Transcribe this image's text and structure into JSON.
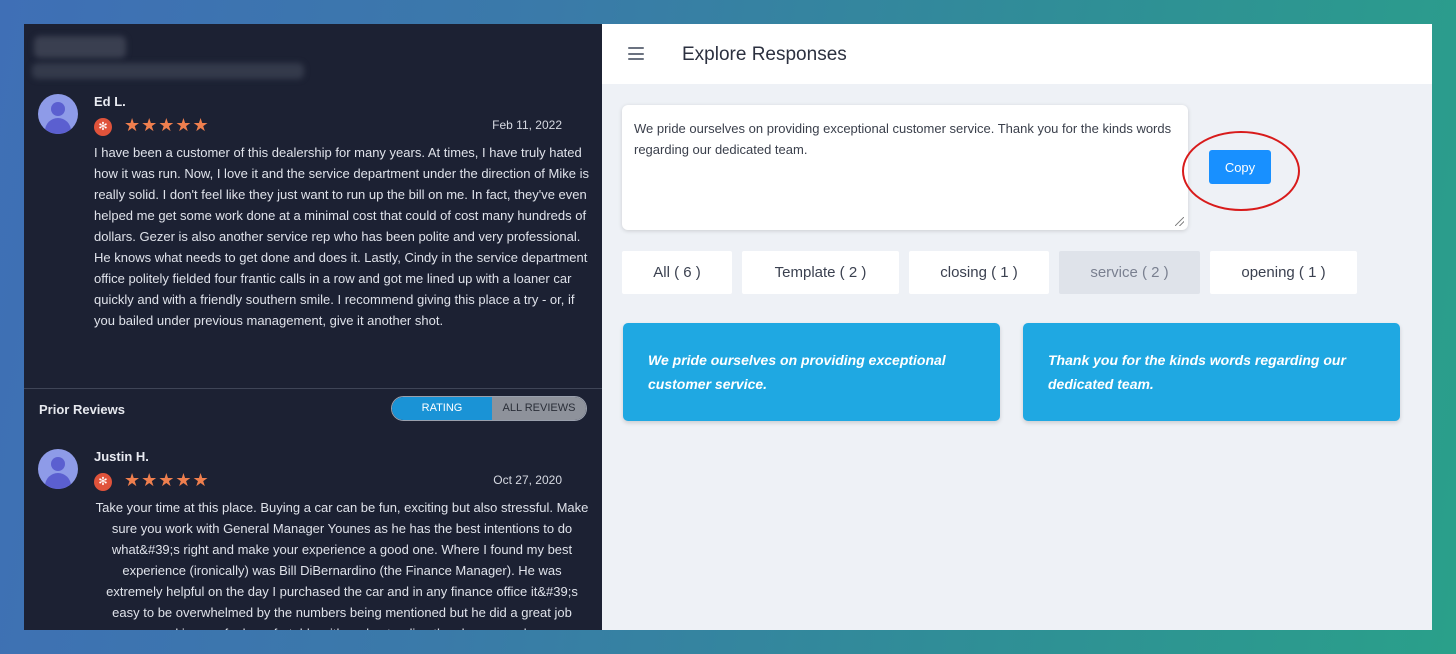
{
  "left": {
    "reviews": [
      {
        "name": "Ed L.",
        "stars": "★★★★★",
        "rating": 5,
        "source_icon": "yelp-icon",
        "date": "Feb 11, 2022",
        "text": "I have been a customer of this dealership for many years. At times, I have truly hated how it was run. Now, I love it and the service department under the direction of Mike is really solid. I don't feel like they just want to run up the bill on me. In fact, they've even helped me get some work done at a minimal cost that could of cost many hundreds of dollars. Gezer is also another service rep who has been polite and very professional.  He knows what needs to get done and does it. Lastly, Cindy in the service department office politely fielded four frantic calls in a row and got me lined up with a loaner car quickly and with a friendly southern smile. I recommend giving this place a try - or, if you bailed under previous management, give it another shot."
      },
      {
        "name": "Justin H.",
        "stars": "★★★★★",
        "rating": 5,
        "source_icon": "yelp-icon",
        "date": "Oct 27, 2020",
        "text": "Take your time at this place. Buying a car can be fun, exciting but also stressful. Make sure you work with General Manager Younes as he has the best intentions to do what&#39;s right and make your experience a good one. Where I found my best experience (ironically) was Bill DiBernardino (the Finance Manager). He was extremely helpful on the day I purchased the car and in any finance office it&#39;s easy to be overwhelmed by the numbers being mentioned but he did a great job making me feel comfortable with understanding the charges and"
      }
    ],
    "prior_reviews_label": "Prior Reviews",
    "toggle": {
      "rating_label": "RATING",
      "all_label": "ALL REVIEWS"
    }
  },
  "right": {
    "title": "Explore Responses",
    "editor_text": "We pride ourselves on providing exceptional customer service. Thank you for the kinds words regarding our dedicated team.",
    "copy_label": "Copy",
    "tabs": [
      {
        "label": "All ( 6 )"
      },
      {
        "label": "Template ( 2 )"
      },
      {
        "label": "closing ( 1 )"
      },
      {
        "label": "service ( 2 )",
        "active": true
      },
      {
        "label": "opening ( 1 )"
      }
    ],
    "cards": [
      {
        "text": "We pride ourselves on providing exceptional customer service."
      },
      {
        "text": "Thank you for the kinds words regarding our dedicated team."
      }
    ]
  },
  "colors": {
    "left_bg": "#1c2133",
    "accent_blue": "#1890ff",
    "card_blue": "#1fa8e2",
    "star_orange": "#ef7f4e",
    "highlight_red": "#d81b1b"
  }
}
